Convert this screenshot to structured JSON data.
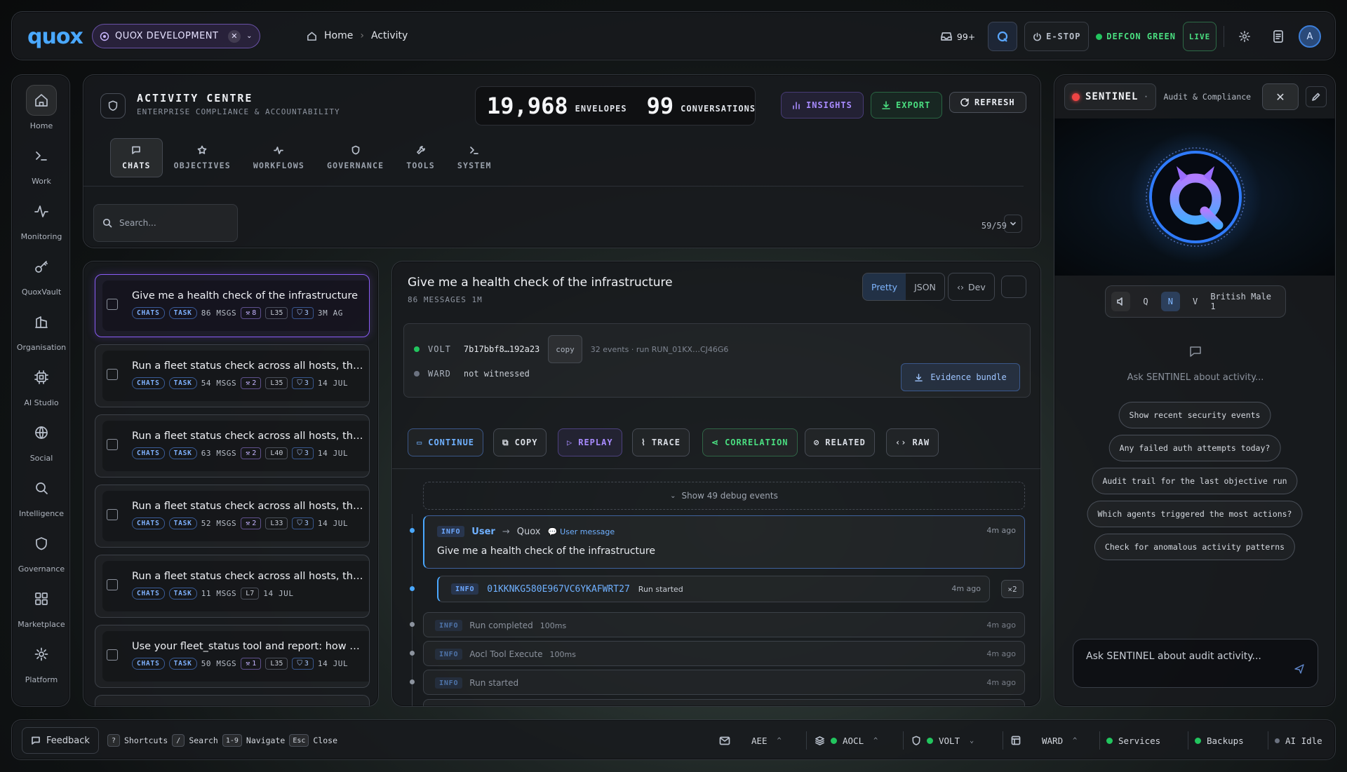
{
  "topbar": {
    "logo": "quox",
    "workspace": "QUOX DEVELOPMENT",
    "breadcrumb": [
      "Home",
      "Activity"
    ],
    "inbox_count": "99+",
    "estop_label": "E-STOP",
    "defcon_label": "DEFCON GREEN",
    "live_label": "LIVE",
    "avatar_initial": "A"
  },
  "nav": [
    {
      "label": "Home",
      "icon": "home-icon"
    },
    {
      "label": "Work",
      "icon": "terminal-icon"
    },
    {
      "label": "Monitoring",
      "icon": "activity-icon"
    },
    {
      "label": "QuoxVault",
      "icon": "key-icon"
    },
    {
      "label": "Organisation",
      "icon": "building-icon"
    },
    {
      "label": "AI Studio",
      "icon": "cpu-icon"
    },
    {
      "label": "Social",
      "icon": "globe-icon"
    },
    {
      "label": "Intelligence",
      "icon": "search-icon"
    },
    {
      "label": "Governance",
      "icon": "shield-icon"
    },
    {
      "label": "Marketplace",
      "icon": "grid-icon"
    },
    {
      "label": "Platform",
      "icon": "gear-icon"
    }
  ],
  "activity": {
    "title": "ACTIVITY CENTRE",
    "subtitle": "ENTERPRISE COMPLIANCE & ACCOUNTABILITY",
    "envelopes_count": "19,968",
    "envelopes_label": "ENVELOPES",
    "conversations_count": "99",
    "conversations_label": "CONVERSATIONS",
    "insights_label": "INSIGHTS",
    "export_label": "EXPORT",
    "refresh_label": "REFRESH",
    "tabs": [
      "CHATS",
      "OBJECTIVES",
      "WORKFLOWS",
      "GOVERNANCE",
      "TOOLS",
      "SYSTEM"
    ],
    "search_placeholder": "Search...",
    "page_count": "59/59"
  },
  "conversations": [
    {
      "title": "Give me a health check of the infrastructure",
      "msgs": "86 MSGS",
      "tools": "8",
      "level": "L35",
      "shield": "3",
      "time": "3M AG"
    },
    {
      "title": "Run a fleet status check across all hosts, then...",
      "msgs": "54 MSGS",
      "tools": "2",
      "level": "L35",
      "shield": "3",
      "time": "14 JUL"
    },
    {
      "title": "Run a fleet status check across all hosts, then...",
      "msgs": "63 MSGS",
      "tools": "2",
      "level": "L40",
      "shield": "3",
      "time": "14 JUL"
    },
    {
      "title": "Run a fleet status check across all hosts, then...",
      "msgs": "52 MSGS",
      "tools": "2",
      "level": "L33",
      "shield": "3",
      "time": "14 JUL"
    },
    {
      "title": "Run a fleet status check across all hosts, then...",
      "msgs": "11 MSGS",
      "tools": "",
      "level": "L7",
      "shield": "",
      "time": "14 JUL"
    },
    {
      "title": "Use your fleet_status tool and report: how many...",
      "msgs": "50 MSGS",
      "tools": "1",
      "level": "L35",
      "shield": "3",
      "time": "14 JUL"
    }
  ],
  "chip_labels": {
    "chats": "CHATS",
    "task": "TASK"
  },
  "detail": {
    "title": "Give me a health check of the infrastructure",
    "subtitle": "86 MESSAGES  1M",
    "view_modes": [
      "Pretty",
      "JSON"
    ],
    "dev_label": "Dev",
    "volt_label": "VOLT",
    "volt_hash": "7b17bbf8…192a23",
    "copy_label": "copy",
    "volt_meta": "32 events · run RUN_01KX…CJ46G6",
    "ward_label": "WARD",
    "ward_status": "not witnessed",
    "evidence_label": "Evidence bundle",
    "actions": [
      "CONTINUE",
      "COPY",
      "REPLAY",
      "TRACE",
      "CORRELATION",
      "RELATED",
      "RAW"
    ],
    "debug_label": "Show 49 debug events",
    "events": [
      {
        "level": "INFO",
        "from": "User",
        "to": "Quox",
        "tag": "User message",
        "text": "Give me a health check of the infrastructure",
        "ago": "4m ago"
      },
      {
        "level": "INFO",
        "run_id": "01KKNKG580E967VC6YKAFWRT27",
        "text": "Run started",
        "ago": "4m ago",
        "count": "×2"
      },
      {
        "level": "INFO",
        "text": "Run completed",
        "dur": "100ms",
        "ago": "4m ago"
      },
      {
        "level": "INFO",
        "text": "Aocl Tool Execute",
        "dur": "100ms",
        "ago": "4m ago"
      },
      {
        "level": "INFO",
        "text": "Run started",
        "dur": "",
        "ago": "4m ago"
      }
    ]
  },
  "sentinel": {
    "name": "SENTINEL",
    "subtitle": "Audit & Compliance",
    "voice_letters": [
      "Q",
      "N",
      "V"
    ],
    "voice_name": "British Male 1",
    "prompt": "Ask SENTINEL about activity...",
    "suggestions": [
      "Show recent security events",
      "Any failed auth attempts today?",
      "Audit trail for the last objective run",
      "Which agents triggered the most actions?",
      "Check for anomalous activity patterns"
    ],
    "input_placeholder": "Ask SENTINEL about audit activity..."
  },
  "bottombar": {
    "feedback": "Feedback",
    "shortcuts": [
      {
        "key": "?",
        "label": "Shortcuts"
      },
      {
        "key": "/",
        "label": "Search"
      },
      {
        "key": "1-9",
        "label": "Navigate"
      },
      {
        "key": "Esc",
        "label": "Close"
      }
    ],
    "aee": "AEE",
    "aocl": "AOCL",
    "volt": "VOLT",
    "ward": "WARD",
    "services": "Services",
    "backups": "Backups",
    "ai_status": "AI Idle"
  },
  "colors": {
    "accent": "#4aa8ff",
    "purple": "#8a5cf6",
    "green": "#22c55e",
    "red": "#ef4444"
  }
}
